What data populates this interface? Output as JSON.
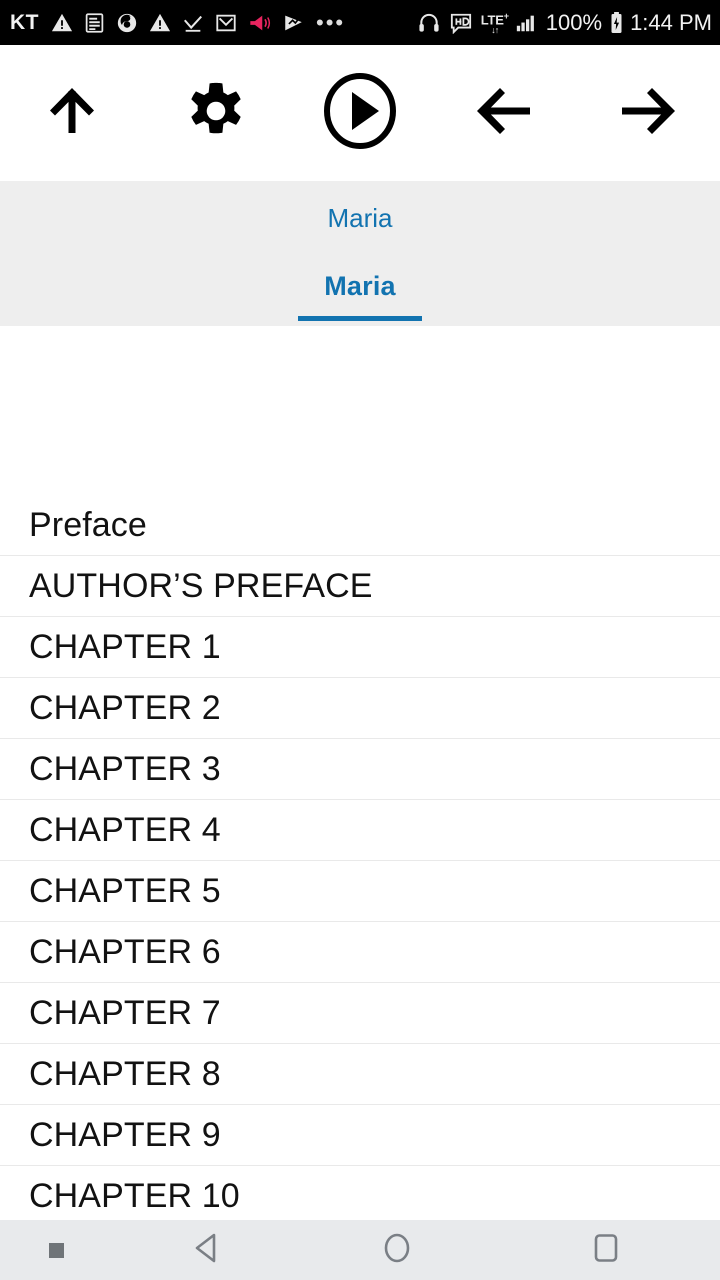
{
  "status_bar": {
    "carrier": "KT",
    "left_icons": [
      {
        "name": "warning-triangle-icon",
        "glyph": "warning"
      },
      {
        "name": "news-document-icon",
        "glyph": "document"
      },
      {
        "name": "firefox-icon",
        "glyph": "firefox"
      },
      {
        "name": "warning-triangle-icon-2",
        "glyph": "warning"
      },
      {
        "name": "checkmark-icon",
        "glyph": "check"
      },
      {
        "name": "gmail-icon",
        "glyph": "gmail"
      },
      {
        "name": "megaphone-icon",
        "glyph": "megaphone",
        "color": "#e8245f"
      },
      {
        "name": "play-store-icon",
        "glyph": "play-triangle"
      }
    ],
    "overflow": "•••",
    "right_icons": [
      {
        "name": "headphones-icon",
        "glyph": "headphones"
      },
      {
        "name": "hd-icon",
        "glyph": "hd"
      }
    ],
    "network_type": "LTE",
    "network_superscript": "+",
    "network_arrows": "↓↑",
    "signal_bars": 4,
    "battery_percent": "100%",
    "clock": "1:44 PM"
  },
  "toolbar": {
    "buttons": [
      {
        "name": "up-arrow-button",
        "icon": "arrow-up-icon",
        "label": "Up"
      },
      {
        "name": "settings-button",
        "icon": "gear-icon",
        "label": "Settings"
      },
      {
        "name": "play-button",
        "icon": "play-circle-icon",
        "label": "Play"
      },
      {
        "name": "previous-button",
        "icon": "arrow-left-icon",
        "label": "Previous"
      },
      {
        "name": "next-button",
        "icon": "arrow-right-icon",
        "label": "Next"
      }
    ]
  },
  "header": {
    "title": "Maria",
    "accent_color": "#1273b0",
    "band_color": "#eeeeee"
  },
  "tabs": [
    {
      "label": "Maria",
      "active": true
    }
  ],
  "content": {
    "items": [
      {
        "label": "Preface"
      },
      {
        "label": "AUTHOR’S PREFACE"
      },
      {
        "label": "CHAPTER 1"
      },
      {
        "label": "CHAPTER 2"
      },
      {
        "label": "CHAPTER 3"
      },
      {
        "label": "CHAPTER 4"
      },
      {
        "label": "CHAPTER 5"
      },
      {
        "label": "CHAPTER 6"
      },
      {
        "label": "CHAPTER 7"
      },
      {
        "label": "CHAPTER 8"
      },
      {
        "label": "CHAPTER 9"
      },
      {
        "label": "CHAPTER 10"
      }
    ]
  },
  "nav_bar": {
    "background": "#e8eaec",
    "items": [
      {
        "name": "nav-dot-indicator",
        "label": "Indicator"
      },
      {
        "name": "nav-back-button",
        "label": "Back"
      },
      {
        "name": "nav-home-button",
        "label": "Home"
      },
      {
        "name": "nav-recents-button",
        "label": "Recents"
      }
    ]
  }
}
